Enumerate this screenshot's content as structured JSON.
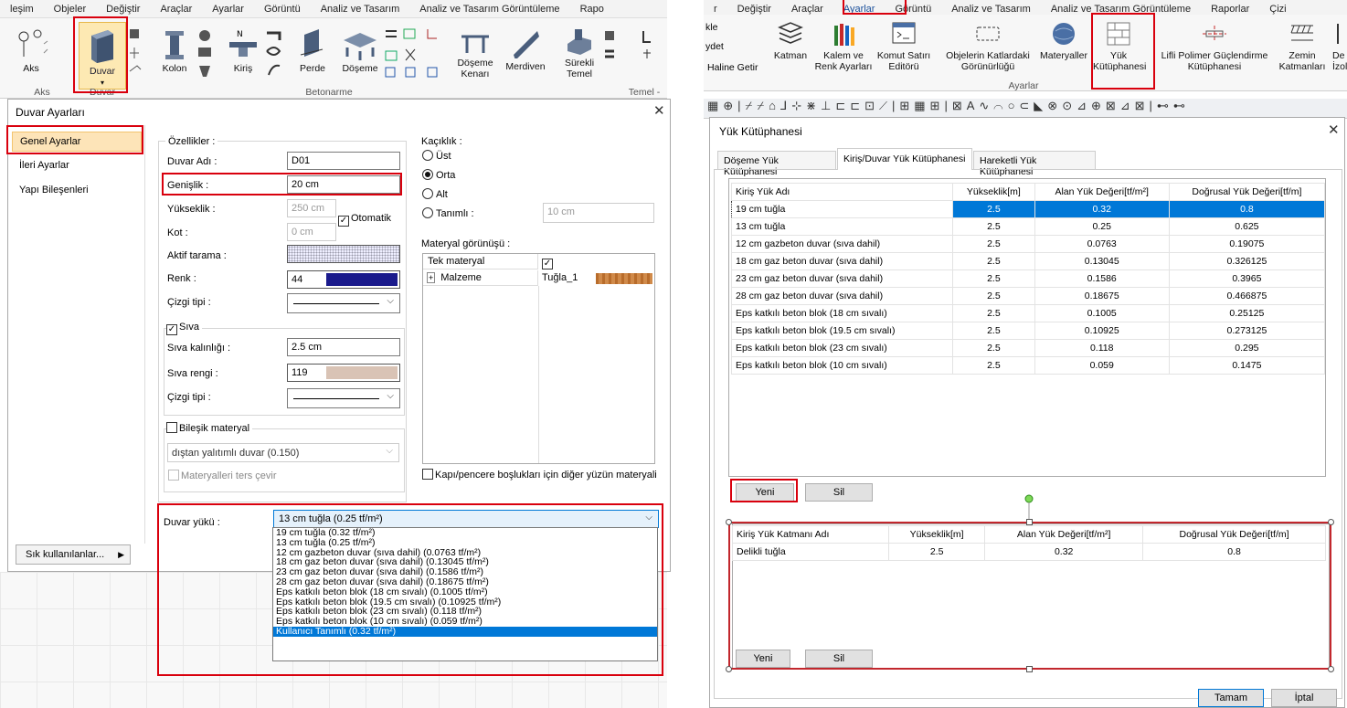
{
  "left_menu": [
    "leşim",
    "Objeler",
    "Değiştir",
    "Araçlar",
    "Ayarlar",
    "Görüntü",
    "Analiz ve Tasarım",
    "Analiz ve Tasarım Görüntüleme",
    "Rapo"
  ],
  "right_menu": [
    "r",
    "Değiştir",
    "Araçlar",
    "Ayarlar",
    "Görüntü",
    "Analiz ve Tasarım",
    "Analiz ve Tasarım Görüntüleme",
    "Raporlar",
    "Çizi"
  ],
  "left_ribbon": {
    "aks": "Aks",
    "duvar": "Duvar",
    "kolon": "Kolon",
    "kiris": "Kiriş",
    "perde": "Perde",
    "doseme": "Döşeme",
    "doseme_kenari": "Döşeme Kenarı",
    "merdiven": "Merdiven",
    "surekli_temel": "Sürekli Temel",
    "groups": {
      "aks": "Aks",
      "duvar": "Duvar",
      "betonarme": "Betonarme",
      "temel": "Temel -"
    }
  },
  "right_ribbon": {
    "partials": [
      "kle",
      "ydet",
      "Haline Getir"
    ],
    "items": [
      "Katman",
      "Kalem ve Renk Ayarları",
      "Komut Satırı Editörü",
      "Objelerin Katlardaki Görünürlüğü",
      "Materyaller",
      "Yük Kütüphanesi",
      "Lifli Polimer Güçlendirme Kütüphanesi",
      "Zemin Katmanları",
      "De İzol"
    ],
    "group": "Ayarlar"
  },
  "duvar_dialog": {
    "title": "Duvar Ayarları",
    "nav": [
      "Genel Ayarlar",
      "İleri Ayarlar",
      "Yapı Bileşenleri"
    ],
    "ozellikler": "Özellikler :",
    "duvar_adi_label": "Duvar Adı :",
    "duvar_adi": "D01",
    "genislik_label": "Genişlik :",
    "genislik": "20 cm",
    "yukseklik_label": "Yükseklik :",
    "yukseklik": "250 cm",
    "otomatik": "Otomatik",
    "kot_label": "Kot :",
    "kot": "0 cm",
    "aktif_tarama": "Aktif tarama :",
    "renk_label": "Renk :",
    "renk": "44",
    "renk_color": "#1a1a8c",
    "cizgi_tipi": "Çizgi tipi :",
    "siva": "Sıva",
    "siva_kalinligi_label": "Sıva kalınlığı :",
    "siva_kalinligi": "2.5 cm",
    "siva_rengi_label": "Sıva rengi :",
    "siva_rengi": "119",
    "siva_color": "#d9c3b5",
    "bilesik": "Bileşik materyal",
    "bilesik_value": "dıştan yalıtımlı duvar (0.150)",
    "ters": "Materyalleri ters çevir",
    "kaciklik": "Kaçıklık :",
    "kaciklik_opts": [
      "Üst",
      "Orta",
      "Alt",
      "Tanımlı :"
    ],
    "tanimli_value": "10 cm",
    "materyal_gorunusu": "Materyal görünüşü :",
    "tek_materyal": "Tek materyal",
    "malzeme": "Malzeme",
    "malzeme_value": "Tuğla_1",
    "kapi": "Kapı/pencere boşlukları için diğer yüzün materyali",
    "sik": "Sık kullanılanlar...",
    "duvar_yuku_label": "Duvar yükü :",
    "duvar_yuku_value": "13 cm tuğla (0.25 tf/m²)",
    "options": [
      "19 cm tuğla (0.32 tf/m²)",
      "13 cm tuğla (0.25 tf/m²)",
      "12 cm gazbeton duvar (sıva dahil) (0.0763 tf/m²)",
      "18 cm gaz beton duvar (sıva dahil) (0.13045 tf/m²)",
      "23 cm gaz beton duvar  (sıva dahil) (0.1586 tf/m²)",
      "28 cm gaz beton duvar  (sıva dahil) (0.18675 tf/m²)",
      "Eps katkılı beton blok (18 cm sıvalı) (0.1005 tf/m²)",
      "Eps katkılı beton blok (19.5 cm sıvalı) (0.10925 tf/m²)",
      "Eps katkılı beton blok (23 cm sıvalı) (0.118 tf/m²)",
      "Eps katkılı beton blok (10 cm sıvalı) (0.059 tf/m²)",
      "Kullanıcı Tanımlı (0.32 tf/m²)"
    ]
  },
  "yuk_dialog": {
    "title": "Yük Kütüphanesi",
    "tabs": [
      "Döşeme Yük Kütüphanesi",
      "Kiriş/Duvar Yük Kütüphanesi",
      "Hareketli Yük Kütüphanesi"
    ],
    "headers": [
      "Kiriş Yük Adı",
      "Yükseklik[m]",
      "Alan Yük Değeri[tf/m²]",
      "Doğrusal Yük Değeri[tf/m]"
    ],
    "rows": [
      [
        "19 cm tuğla",
        "2.5",
        "0.32",
        "0.8"
      ],
      [
        "13 cm tuğla",
        "2.5",
        "0.25",
        "0.625"
      ],
      [
        "12 cm gazbeton duvar (sıva dahil)",
        "2.5",
        "0.0763",
        "0.19075"
      ],
      [
        "18 cm gaz beton duvar (sıva dahil)",
        "2.5",
        "0.13045",
        "0.326125"
      ],
      [
        "23 cm gaz beton duvar  (sıva dahil)",
        "2.5",
        "0.1586",
        "0.3965"
      ],
      [
        "28 cm gaz beton duvar  (sıva dahil)",
        "2.5",
        "0.18675",
        "0.466875"
      ],
      [
        "Eps katkılı beton blok (18 cm sıvalı)",
        "2.5",
        "0.1005",
        "0.25125"
      ],
      [
        "Eps katkılı beton blok (19.5 cm sıvalı)",
        "2.5",
        "0.10925",
        "0.273125"
      ],
      [
        "Eps katkılı beton blok (23 cm sıvalı)",
        "2.5",
        "0.118",
        "0.295"
      ],
      [
        "Eps katkılı beton blok (10 cm sıvalı)",
        "2.5",
        "0.059",
        "0.1475"
      ]
    ],
    "yeni": "Yeni",
    "sil": "Sil",
    "layer_headers": [
      "Kiriş Yük Katmanı Adı",
      "Yükseklik[m]",
      "Alan Yük Değeri[tf/m²]",
      "Doğrusal Yük Değeri[tf/m]"
    ],
    "layer_rows": [
      [
        "Delikli tuğla",
        "2.5",
        "0.32",
        "0.8"
      ]
    ],
    "tamam": "Tamam",
    "iptal": "İptal"
  }
}
